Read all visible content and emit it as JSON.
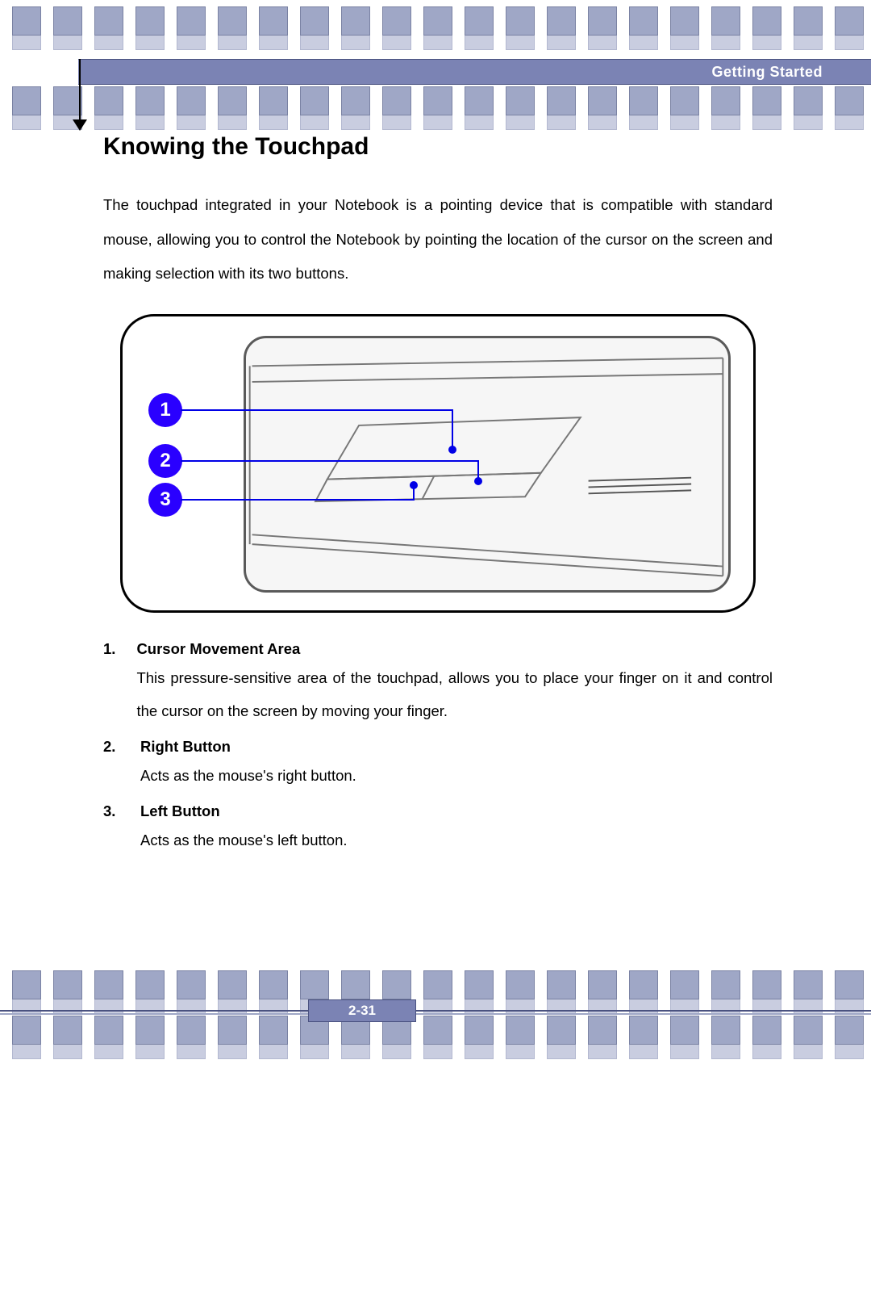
{
  "header": {
    "section": "Getting Started"
  },
  "page": {
    "heading": "Knowing the Touchpad",
    "intro": "The touchpad integrated in your Notebook is a pointing device that is compatible with standard mouse, allowing you to control the Notebook by pointing the location of the cursor on the screen and making selection with its two buttons.",
    "page_number": "2-31"
  },
  "callouts": {
    "c1": "1",
    "c2": "2",
    "c3": "3"
  },
  "list": [
    {
      "num": "1.",
      "title": "Cursor Movement Area",
      "text": "This pressure-sensitive area of the touchpad, allows you to place your finger on it and control the cursor on the screen by moving your finger."
    },
    {
      "num": "2.",
      "title": "Right Button",
      "text": "Acts as the mouse's right button."
    },
    {
      "num": "3.",
      "title": "Left Button",
      "text": "Acts as the mouse's left button."
    }
  ]
}
